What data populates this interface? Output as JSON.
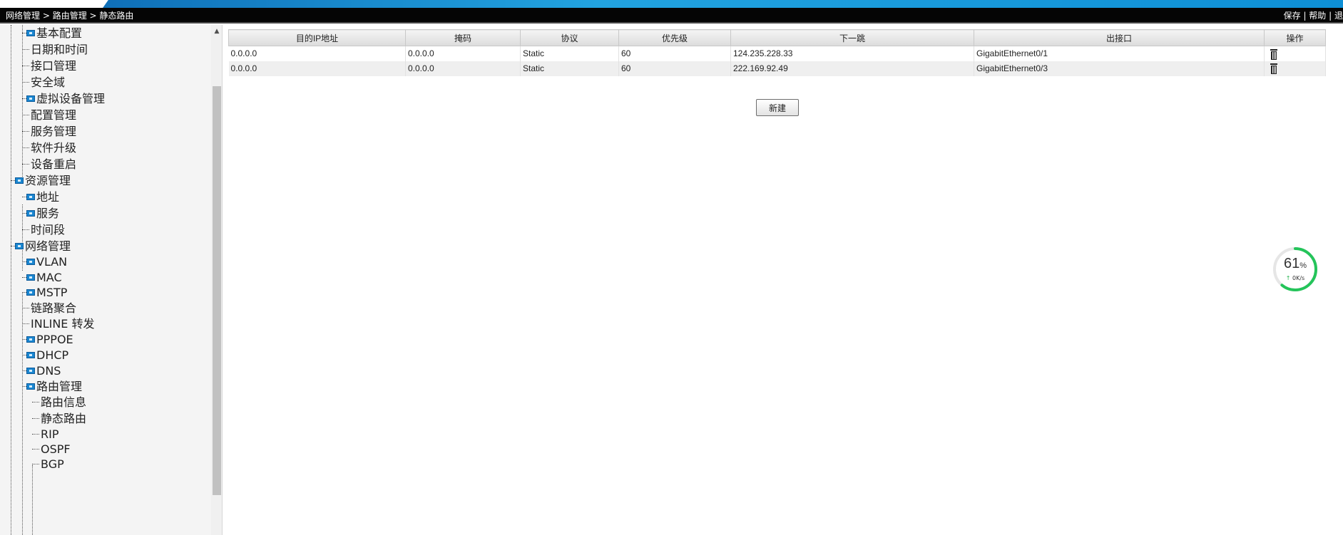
{
  "breadcrumb": {
    "items": [
      "网络管理",
      "路由管理",
      "静态路由"
    ],
    "separator": " > "
  },
  "toplinks": {
    "save": "保存",
    "help": "帮助",
    "exit": "退"
  },
  "sidebar": {
    "items": [
      {
        "label": "基本配置",
        "icon": "folder-icon"
      },
      {
        "label": "日期和时间"
      },
      {
        "label": "接口管理"
      },
      {
        "label": "安全域"
      },
      {
        "label": "虚拟设备管理",
        "icon": "folder-icon"
      },
      {
        "label": "配置管理"
      },
      {
        "label": "服务管理"
      },
      {
        "label": "软件升级"
      },
      {
        "label": "设备重启"
      },
      {
        "label": "资源管理",
        "icon": "folder-icon"
      },
      {
        "label": "地址",
        "icon": "folder-icon"
      },
      {
        "label": "服务",
        "icon": "folder-icon"
      },
      {
        "label": "时间段"
      },
      {
        "label": "网络管理",
        "icon": "folder-icon"
      },
      {
        "label": "VLAN",
        "icon": "folder-icon"
      },
      {
        "label": "MAC",
        "icon": "folder-icon"
      },
      {
        "label": "MSTP",
        "icon": "folder-icon"
      },
      {
        "label": "链路聚合"
      },
      {
        "label": "INLINE 转发"
      },
      {
        "label": "PPPOE",
        "icon": "folder-icon"
      },
      {
        "label": "DHCP",
        "icon": "folder-icon"
      },
      {
        "label": "DNS",
        "icon": "folder-icon"
      },
      {
        "label": "路由管理",
        "icon": "folder-icon"
      },
      {
        "label": "路由信息"
      },
      {
        "label": "静态路由"
      },
      {
        "label": "RIP"
      },
      {
        "label": "OSPF"
      },
      {
        "label": "BGP"
      }
    ]
  },
  "routes_table": {
    "columns": [
      "目的IP地址",
      "掩码",
      "协议",
      "优先级",
      "下一跳",
      "出接口",
      "操作"
    ],
    "rows": [
      {
        "dest": "0.0.0.0",
        "mask": "0.0.0.0",
        "protocol": "Static",
        "priority": "60",
        "next_hop": "124.235.228.33",
        "interface": "GigabitEthernet0/1"
      },
      {
        "dest": "0.0.0.0",
        "mask": "0.0.0.0",
        "protocol": "Static",
        "priority": "60",
        "next_hop": "222.169.92.49",
        "interface": "GigabitEthernet0/3"
      }
    ]
  },
  "actions": {
    "new_label": "新建"
  },
  "speed_widget": {
    "percent": "61",
    "percent_sign": "%",
    "rate": "0K/s",
    "progress": 0.61,
    "ring_color": "#24c45a"
  },
  "icons": {
    "delete": "trash-icon",
    "tree_node": "folder-icon",
    "scroll_up": "scroll-up-arrow-icon",
    "upload": "upload-arrow-icon"
  },
  "colors": {
    "navbar_bg": "#050505",
    "banner_blue": "#22a3e0",
    "sidebar_bg": "#f4f4f4",
    "node_icon": "#1a86d0"
  }
}
